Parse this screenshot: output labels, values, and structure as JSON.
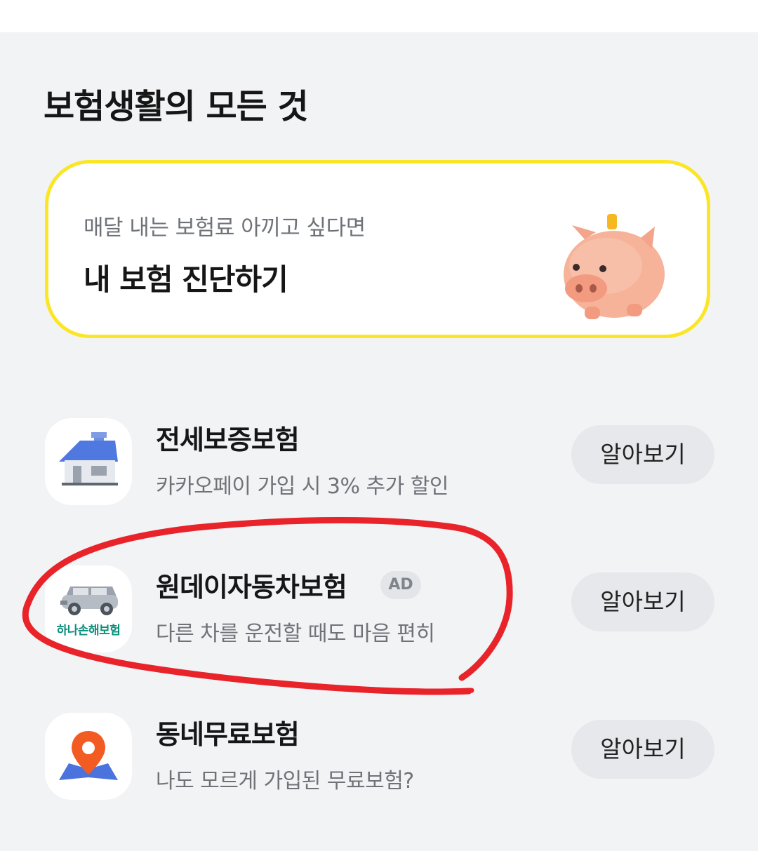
{
  "section": {
    "title": "보험생활의 모든 것"
  },
  "diagnosis_card": {
    "subtitle": "매달 내는 보험료 아끼고 싶다면",
    "title": "내 보험 진단하기",
    "icon": "piggy-bank-icon"
  },
  "products": [
    {
      "title": "전세보증보험",
      "description": "카카오페이 가입 시 3% 추가 할인",
      "button": "알아보기",
      "icon": "house-icon"
    },
    {
      "title": "원데이자동차보험",
      "badge": "AD",
      "description": "다른 차를 운전할 때도 마음 편히",
      "button": "알아보기",
      "icon": "car-icon",
      "brand": "하나손해보험"
    },
    {
      "title": "동네무료보험",
      "description": "나도 모르게 가입된 무료보험?",
      "button": "알아보기",
      "icon": "map-pin-icon"
    }
  ],
  "colors": {
    "background": "#f2f3f5",
    "card_border": "#fbe625",
    "annotation": "#e8232a",
    "brand_green": "#0b8f7c"
  }
}
